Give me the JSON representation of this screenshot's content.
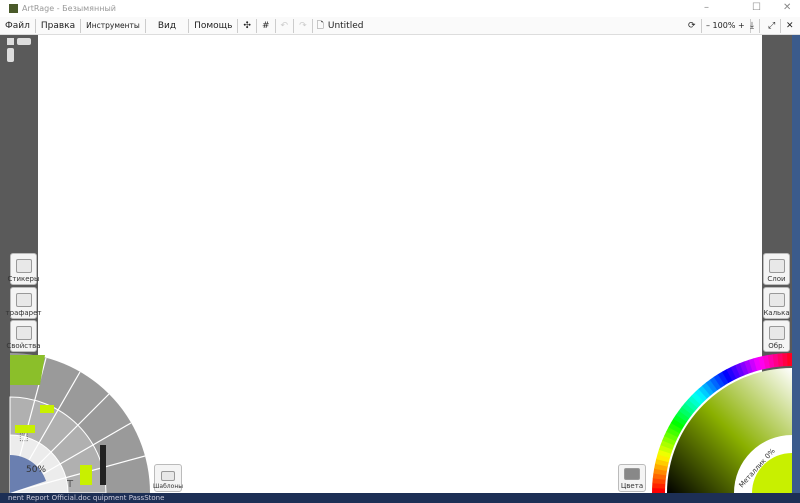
{
  "window": {
    "title": "ArtRage - Безымянный",
    "minimize": "–",
    "maximize": "☐",
    "close": "✕"
  },
  "menu": {
    "items": [
      "Файл",
      "Правка",
      "Инструменты",
      "Вид",
      "Помощь"
    ],
    "doc_title": "Untitled",
    "zoom": "– 100% +"
  },
  "left_panels": {
    "stickers": "Стикеры",
    "stencil": "трафарет",
    "properties": "Свойства"
  },
  "right_panels": {
    "layers": "Слои",
    "tracing": "Калька",
    "reference": "Обр."
  },
  "tools": {
    "size": "50%",
    "presets": "Шаблоны"
  },
  "colors": {
    "label": "Цвета",
    "metallic": "Металлик 0%",
    "current": "#c8f000"
  },
  "taskbar": {
    "text": "nent Report Official.doc  quipment      PassStone"
  }
}
